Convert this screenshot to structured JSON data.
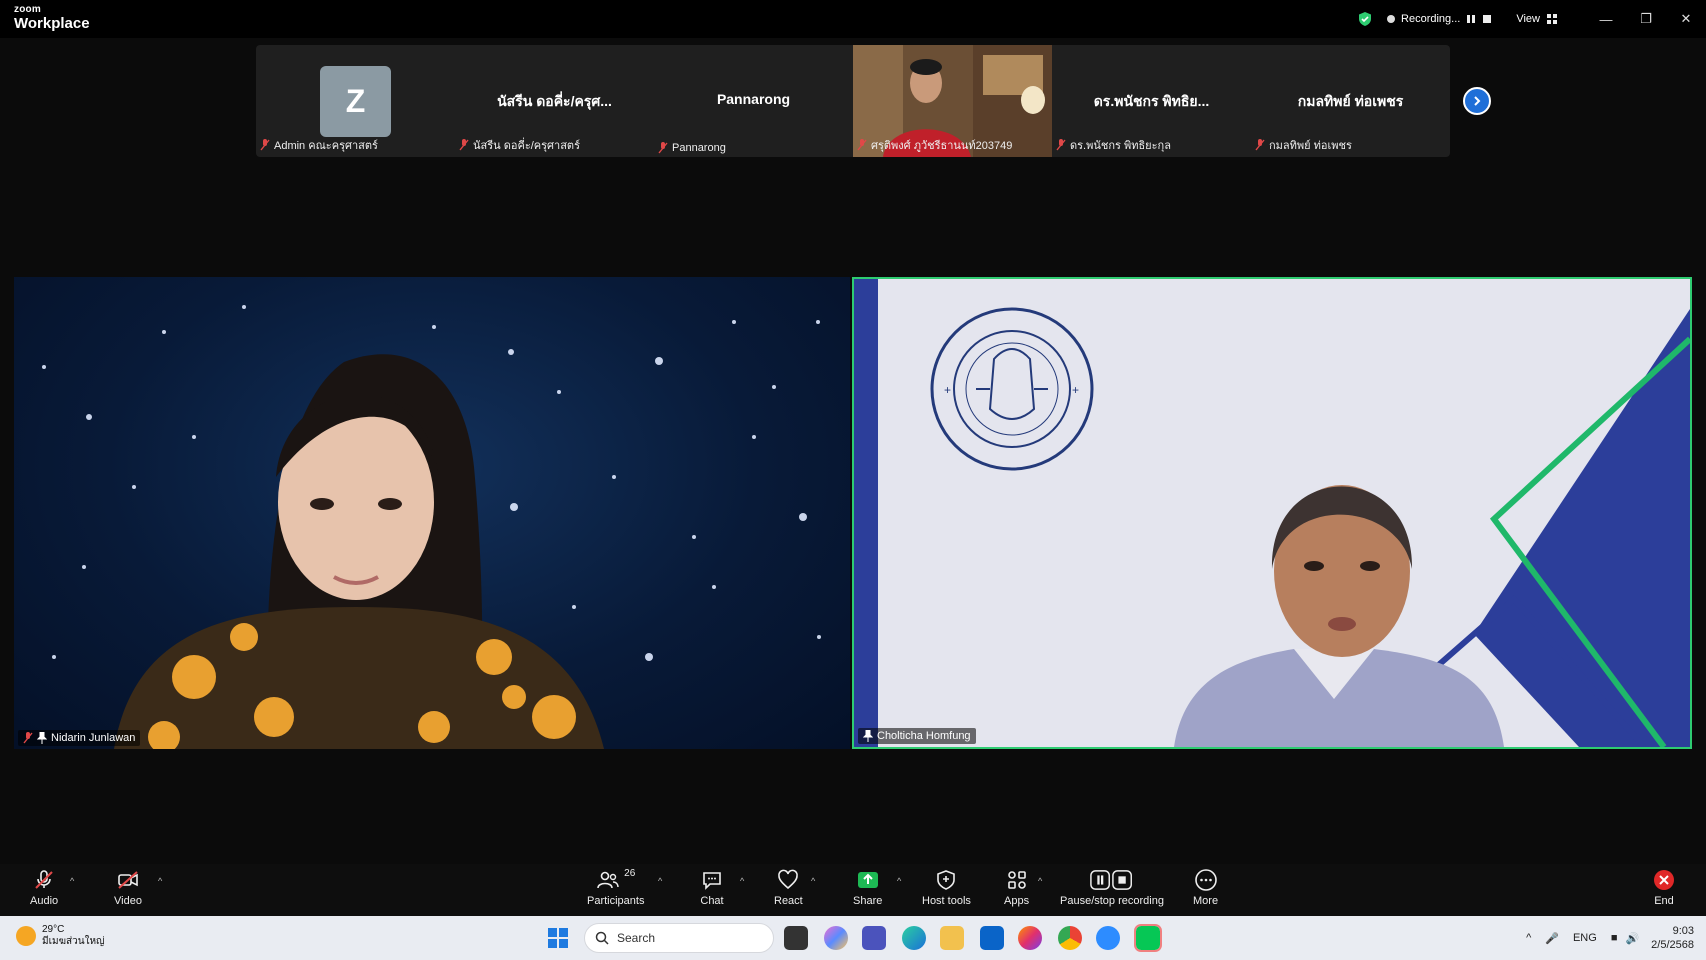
{
  "titlebar": {
    "brand_top": "zoom",
    "brand_bottom": "Workplace",
    "recording_label": "Recording...",
    "view_label": "View"
  },
  "gallery": {
    "tiles": [
      {
        "big": "",
        "caption": "Admin คณะครุศาสตร์",
        "avatar_letter": "Z"
      },
      {
        "big": "นัสรีน ดอคี่ะ/ครุศ...",
        "caption": "นัสรีน ดอคี่ะ/ครุศาสตร์"
      },
      {
        "big": "Pannarong",
        "caption": "Pannarong"
      },
      {
        "big": "",
        "caption": "ศรุติพงศ์ ภูวัชรีธานนท์203749"
      },
      {
        "big": "ดร.พนัชกร พิทธิย...",
        "caption": "ดร.พนัชกร พิทธิยะกุล"
      },
      {
        "big": "กมลทิพย์ ท่อเพชร",
        "caption": "กมลทิพย์ ท่อเพชร"
      }
    ]
  },
  "main_videos": {
    "left_name": "Nidarin Junlawan",
    "right_name": "Cholticha Homfung"
  },
  "toolbar": {
    "audio": "Audio",
    "video": "Video",
    "participants": "Participants",
    "participants_count": "26",
    "chat": "Chat",
    "react": "React",
    "share": "Share",
    "host_tools": "Host tools",
    "apps": "Apps",
    "pause_stop_recording": "Pause/stop recording",
    "more": "More",
    "end": "End"
  },
  "taskbar": {
    "temp": "29°C",
    "weather_desc": "มีเมฆส่วนใหญ่",
    "search_placeholder": "Search",
    "lang": "ENG",
    "time": "9:03",
    "date": "2/5/2568"
  },
  "colors": {
    "active_speaker_border": "#2ecc71",
    "share_green": "#1db954",
    "end_red": "#e02828",
    "next_blue": "#1f6fd8"
  }
}
